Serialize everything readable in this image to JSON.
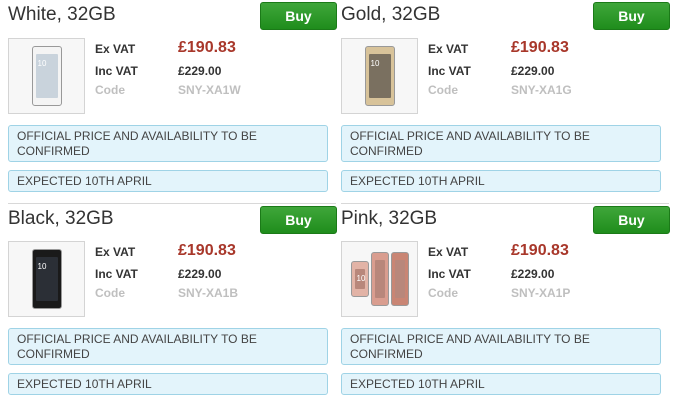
{
  "products": [
    {
      "title": "White, 32GB",
      "buy_label": "Buy",
      "ex_vat_label": "Ex VAT",
      "ex_vat_price": "£190.83",
      "inc_vat_label": "Inc VAT",
      "inc_vat_price": "£229.00",
      "code_label": "Code",
      "code": "SNY-XA1W",
      "official_notice": "OFFICIAL PRICE AND AVAILABILITY TO BE CONFIRMED",
      "expected_notice": "EXPECTED 10TH APRIL",
      "phone_colors": [
        "#f4f4f4"
      ],
      "screen_color": "#c9d3dc",
      "image_clock": "10"
    },
    {
      "title": "Gold, 32GB",
      "buy_label": "Buy",
      "ex_vat_label": "Ex VAT",
      "ex_vat_price": "£190.83",
      "inc_vat_label": "Inc VAT",
      "inc_vat_price": "£229.00",
      "code_label": "Code",
      "code": "SNY-XA1G",
      "official_notice": "OFFICIAL PRICE AND AVAILABILITY TO BE CONFIRMED",
      "expected_notice": "EXPECTED 10TH APRIL",
      "phone_colors": [
        "#d8c39a"
      ],
      "screen_color": "#7a7060",
      "image_clock": "10"
    },
    {
      "title": "Black, 32GB",
      "buy_label": "Buy",
      "ex_vat_label": "Ex VAT",
      "ex_vat_price": "£190.83",
      "inc_vat_label": "Inc VAT",
      "inc_vat_price": "£229.00",
      "code_label": "Code",
      "code": "SNY-XA1B",
      "official_notice": "OFFICIAL PRICE AND AVAILABILITY TO BE CONFIRMED",
      "expected_notice": "EXPECTED 10TH APRIL",
      "phone_colors": [
        "#1a1a1a"
      ],
      "screen_color": "#2b2f36",
      "image_clock": "10"
    },
    {
      "title": "Pink, 32GB",
      "buy_label": "Buy",
      "ex_vat_label": "Ex VAT",
      "ex_vat_price": "£190.83",
      "inc_vat_label": "Inc VAT",
      "inc_vat_price": "£229.00",
      "code_label": "Code",
      "code": "SNY-XA1P",
      "official_notice": "OFFICIAL PRICE AND AVAILABILITY TO BE CONFIRMED",
      "expected_notice": "EXPECTED 10TH APRIL",
      "phone_colors": [
        "#e2b3a6",
        "#d99d8f",
        "#c98574"
      ],
      "screen_color": "#b8877b",
      "image_clock": "10"
    }
  ],
  "colors": {
    "buy_button": "#2a9a26",
    "price_red": "#a8372a",
    "notice_bg": "#e3f4fb",
    "notice_border": "#9fd3e6"
  }
}
